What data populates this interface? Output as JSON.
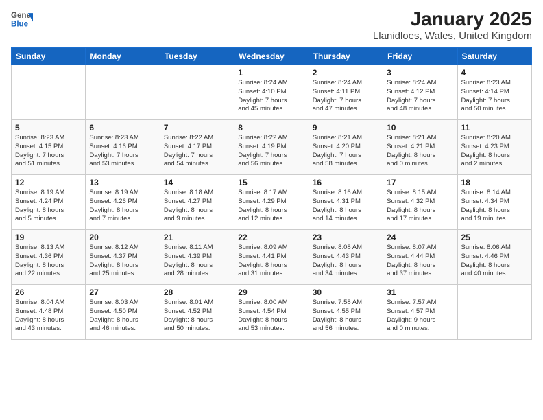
{
  "header": {
    "logo_line1": "General",
    "logo_line2": "Blue",
    "title": "January 2025",
    "subtitle": "Llanidloes, Wales, United Kingdom"
  },
  "weekdays": [
    "Sunday",
    "Monday",
    "Tuesday",
    "Wednesday",
    "Thursday",
    "Friday",
    "Saturday"
  ],
  "weeks": [
    [
      {
        "day": "",
        "detail": ""
      },
      {
        "day": "",
        "detail": ""
      },
      {
        "day": "",
        "detail": ""
      },
      {
        "day": "1",
        "detail": "Sunrise: 8:24 AM\nSunset: 4:10 PM\nDaylight: 7 hours\nand 45 minutes."
      },
      {
        "day": "2",
        "detail": "Sunrise: 8:24 AM\nSunset: 4:11 PM\nDaylight: 7 hours\nand 47 minutes."
      },
      {
        "day": "3",
        "detail": "Sunrise: 8:24 AM\nSunset: 4:12 PM\nDaylight: 7 hours\nand 48 minutes."
      },
      {
        "day": "4",
        "detail": "Sunrise: 8:23 AM\nSunset: 4:14 PM\nDaylight: 7 hours\nand 50 minutes."
      }
    ],
    [
      {
        "day": "5",
        "detail": "Sunrise: 8:23 AM\nSunset: 4:15 PM\nDaylight: 7 hours\nand 51 minutes."
      },
      {
        "day": "6",
        "detail": "Sunrise: 8:23 AM\nSunset: 4:16 PM\nDaylight: 7 hours\nand 53 minutes."
      },
      {
        "day": "7",
        "detail": "Sunrise: 8:22 AM\nSunset: 4:17 PM\nDaylight: 7 hours\nand 54 minutes."
      },
      {
        "day": "8",
        "detail": "Sunrise: 8:22 AM\nSunset: 4:19 PM\nDaylight: 7 hours\nand 56 minutes."
      },
      {
        "day": "9",
        "detail": "Sunrise: 8:21 AM\nSunset: 4:20 PM\nDaylight: 7 hours\nand 58 minutes."
      },
      {
        "day": "10",
        "detail": "Sunrise: 8:21 AM\nSunset: 4:21 PM\nDaylight: 8 hours\nand 0 minutes."
      },
      {
        "day": "11",
        "detail": "Sunrise: 8:20 AM\nSunset: 4:23 PM\nDaylight: 8 hours\nand 2 minutes."
      }
    ],
    [
      {
        "day": "12",
        "detail": "Sunrise: 8:19 AM\nSunset: 4:24 PM\nDaylight: 8 hours\nand 5 minutes."
      },
      {
        "day": "13",
        "detail": "Sunrise: 8:19 AM\nSunset: 4:26 PM\nDaylight: 8 hours\nand 7 minutes."
      },
      {
        "day": "14",
        "detail": "Sunrise: 8:18 AM\nSunset: 4:27 PM\nDaylight: 8 hours\nand 9 minutes."
      },
      {
        "day": "15",
        "detail": "Sunrise: 8:17 AM\nSunset: 4:29 PM\nDaylight: 8 hours\nand 12 minutes."
      },
      {
        "day": "16",
        "detail": "Sunrise: 8:16 AM\nSunset: 4:31 PM\nDaylight: 8 hours\nand 14 minutes."
      },
      {
        "day": "17",
        "detail": "Sunrise: 8:15 AM\nSunset: 4:32 PM\nDaylight: 8 hours\nand 17 minutes."
      },
      {
        "day": "18",
        "detail": "Sunrise: 8:14 AM\nSunset: 4:34 PM\nDaylight: 8 hours\nand 19 minutes."
      }
    ],
    [
      {
        "day": "19",
        "detail": "Sunrise: 8:13 AM\nSunset: 4:36 PM\nDaylight: 8 hours\nand 22 minutes."
      },
      {
        "day": "20",
        "detail": "Sunrise: 8:12 AM\nSunset: 4:37 PM\nDaylight: 8 hours\nand 25 minutes."
      },
      {
        "day": "21",
        "detail": "Sunrise: 8:11 AM\nSunset: 4:39 PM\nDaylight: 8 hours\nand 28 minutes."
      },
      {
        "day": "22",
        "detail": "Sunrise: 8:09 AM\nSunset: 4:41 PM\nDaylight: 8 hours\nand 31 minutes."
      },
      {
        "day": "23",
        "detail": "Sunrise: 8:08 AM\nSunset: 4:43 PM\nDaylight: 8 hours\nand 34 minutes."
      },
      {
        "day": "24",
        "detail": "Sunrise: 8:07 AM\nSunset: 4:44 PM\nDaylight: 8 hours\nand 37 minutes."
      },
      {
        "day": "25",
        "detail": "Sunrise: 8:06 AM\nSunset: 4:46 PM\nDaylight: 8 hours\nand 40 minutes."
      }
    ],
    [
      {
        "day": "26",
        "detail": "Sunrise: 8:04 AM\nSunset: 4:48 PM\nDaylight: 8 hours\nand 43 minutes."
      },
      {
        "day": "27",
        "detail": "Sunrise: 8:03 AM\nSunset: 4:50 PM\nDaylight: 8 hours\nand 46 minutes."
      },
      {
        "day": "28",
        "detail": "Sunrise: 8:01 AM\nSunset: 4:52 PM\nDaylight: 8 hours\nand 50 minutes."
      },
      {
        "day": "29",
        "detail": "Sunrise: 8:00 AM\nSunset: 4:54 PM\nDaylight: 8 hours\nand 53 minutes."
      },
      {
        "day": "30",
        "detail": "Sunrise: 7:58 AM\nSunset: 4:55 PM\nDaylight: 8 hours\nand 56 minutes."
      },
      {
        "day": "31",
        "detail": "Sunrise: 7:57 AM\nSunset: 4:57 PM\nDaylight: 9 hours\nand 0 minutes."
      },
      {
        "day": "",
        "detail": ""
      }
    ]
  ]
}
